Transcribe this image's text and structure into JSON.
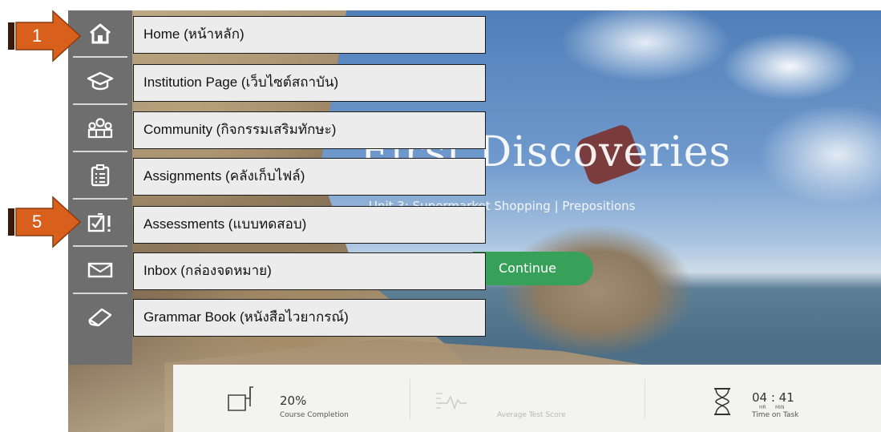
{
  "hero": {
    "title": "First Discoveries",
    "subtitle": "Unit 3: Supermarket Shopping | Prepositions",
    "continue_label": "Continue"
  },
  "sidebar": {
    "items": [
      {
        "icon": "home-icon"
      },
      {
        "icon": "graduation-cap-icon"
      },
      {
        "icon": "community-icon"
      },
      {
        "icon": "clipboard-icon"
      },
      {
        "icon": "assessment-icon"
      },
      {
        "icon": "envelope-icon"
      },
      {
        "icon": "book-icon"
      }
    ]
  },
  "callouts": [
    "Home (หน้าหลัก)",
    "Institution Page (เว็บไซต์สถาบัน)",
    "Community (กิจกรรมเสริมทักษะ)",
    "Assignments (คลังเก็บไฟล์)",
    "Assessments (แบบทดสอบ)",
    "Inbox (กล่องจดหมาย)",
    "Grammar Book (หนังสือไวยากรณ์)"
  ],
  "markers": {
    "first": "1",
    "second": "5"
  },
  "stats": {
    "completion_value": "20%",
    "completion_label": "Course Completion",
    "avg_score_label": "Average Test Score",
    "time_value": "04 : 41",
    "time_hr": "HR",
    "time_min": "MIN",
    "time_label": "Time on Task"
  },
  "colors": {
    "sidebar": "#6e6e6e",
    "marker": "#d9601c",
    "continue": "#37a15a"
  }
}
